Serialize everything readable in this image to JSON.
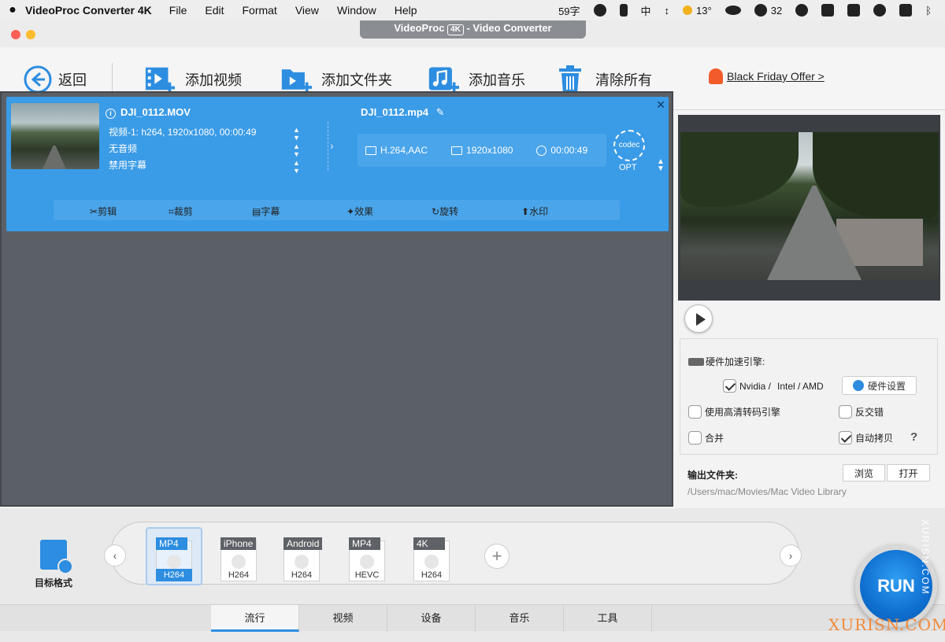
{
  "menubar": {
    "apple": "",
    "app_name": "VideoProc Converter 4K",
    "menus": [
      "File",
      "Edit",
      "Format",
      "View",
      "Window",
      "Help"
    ],
    "status": {
      "chars": "59字",
      "ime": "中",
      "temp": "13°",
      "wechat_count": "32"
    }
  },
  "window": {
    "title_prefix": "VideoProc",
    "title_badge": "4K",
    "title_suffix": "- Video Converter"
  },
  "toolbar": {
    "back": "返回",
    "add_video": "添加视频",
    "add_folder": "添加文件夹",
    "add_music": "添加音乐",
    "clear_all": "清除所有",
    "offer": "Black Friday Offer >"
  },
  "item": {
    "source_name": "DJI_0112.MOV",
    "video_track": "视频-1: h264, 1920x1080, 00:00:49",
    "audio_track": "无音频",
    "subtitle_track": "禁用字幕",
    "output_name": "DJI_0112.mp4",
    "out_codec": "H.264,AAC",
    "out_resolution": "1920x1080",
    "out_duration": "00:00:49",
    "codec_label": "codec",
    "opt_label": "OPT",
    "edit": {
      "cut": "剪辑",
      "crop": "裁剪",
      "subtitle": "字幕",
      "effect": "效果",
      "rotate": "旋转",
      "watermark": "水印"
    }
  },
  "settings": {
    "hw_title": "硬件加速引擎:",
    "nvidia": "Nvidia /",
    "intel": "Intel / AMD",
    "hw_settings": "硬件设置",
    "hq_engine": "使用高清转码引擎",
    "deinterlace": "反交错",
    "merge": "合并",
    "auto_copy": "自动拷贝",
    "help": "?",
    "nvidia_checked": true,
    "auto_copy_checked": true
  },
  "output": {
    "label": "输出文件夹:",
    "browse": "浏览",
    "open": "打开",
    "path": "/Users/mac/Movies/Mac Video Library"
  },
  "formats": {
    "target_label": "目标格式",
    "items": [
      {
        "top": "MP4",
        "codec": "H264"
      },
      {
        "top": "iPhone",
        "codec": "H264"
      },
      {
        "top": "Android",
        "codec": "H264"
      },
      {
        "top": "MP4",
        "codec": "HEVC"
      },
      {
        "top": "4K",
        "codec": "H264"
      }
    ],
    "selected_index": 0
  },
  "tabs": [
    "流行",
    "视频",
    "设备",
    "音乐",
    "工具"
  ],
  "run": "RUN",
  "watermark": "XURISN.COM",
  "colors": {
    "accent": "#2d8de0",
    "card": "#3a9be7",
    "offer_bell": "#f25b2a"
  }
}
